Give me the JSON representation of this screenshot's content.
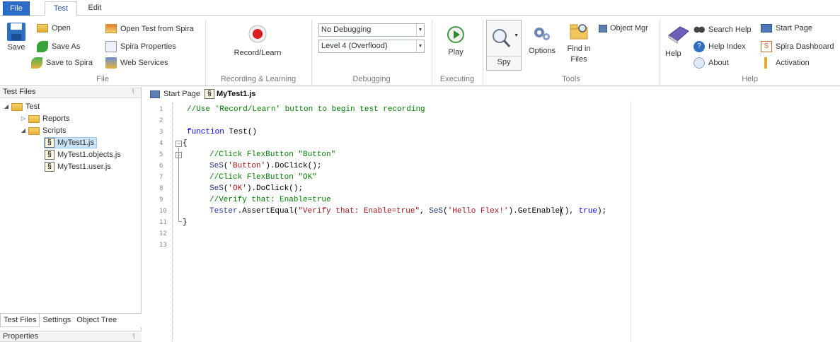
{
  "menu_tabs": [
    "File",
    "Test",
    "Edit"
  ],
  "ribbon": {
    "file": {
      "save": "Save",
      "open": "Open",
      "save_as": "Save As",
      "save_to_spira": "Save to Spira",
      "open_from_spira": "Open Test from Spira",
      "spira_properties": "Spira Properties",
      "web_services": "Web Services",
      "label": "File"
    },
    "recording": {
      "record_learn": "Record/Learn",
      "label": "Recording & Learning"
    },
    "debugging": {
      "mode": "No Debugging",
      "level": "Level 4 (Overflood)",
      "label": "Debugging"
    },
    "executing": {
      "play": "Play",
      "label": "Executing"
    },
    "tools": {
      "spy": "Spy",
      "options": "Options",
      "find_in_files_1": "Find in",
      "find_in_files_2": "Files",
      "object_mgr": "Object Mgr",
      "label": "Tools"
    },
    "help": {
      "help": "Help",
      "search_help": "Search Help",
      "help_index": "Help Index",
      "about": "About",
      "start_page": "Start Page",
      "spira_dashboard": "Spira Dashboard",
      "activation": "Activation",
      "label": "Help"
    }
  },
  "left_panel": {
    "title": "Test Files",
    "tree": {
      "root": "Test",
      "reports": "Reports",
      "scripts": "Scripts",
      "file1": "MyTest1.js",
      "file2": "MyTest1.objects.js",
      "file3": "MyTest1.user.js"
    },
    "tabs": [
      "Test Files",
      "Settings",
      "Object Tree"
    ],
    "properties_title": "Properties"
  },
  "editor": {
    "tabs": [
      "Start Page",
      "MyTest1.js"
    ],
    "line_numbers": [
      "1",
      "2",
      "3",
      "4",
      "5",
      "6",
      "7",
      "8",
      "9",
      "10",
      "11",
      "12",
      "13"
    ],
    "code": {
      "l1": "//Use 'Record/Learn' button to begin test recording",
      "l3_kw": "function",
      "l3_rest": " Test()",
      "l4": "{",
      "l5": "//Click FlexButton \"Button\"",
      "l6_fn": "SeS",
      "l6_a": "(",
      "l6_str": "'Button'",
      "l6_b": ").DoClick();",
      "l7": "//Click FlexButton \"OK\"",
      "l8_fn": "SeS",
      "l8_a": "(",
      "l8_str": "'OK'",
      "l8_b": ").DoClick();",
      "l9": "//Verify that: Enable=true",
      "l10_obj": "Tester",
      "l10_a": ".AssertEqual(",
      "l10_str1": "\"Verify that: Enable=true\"",
      "l10_b": ", ",
      "l10_fn": "SeS",
      "l10_c": "(",
      "l10_str2": "'Hello Flex!'",
      "l10_d": ").GetEnable(), ",
      "l10_lit": "true",
      "l10_e": ");",
      "l11": "}"
    }
  },
  "colors": {
    "file_tab": "#2b6bc9",
    "comment": "#008000",
    "keyword": "#0000ff",
    "string": "#a31515"
  }
}
